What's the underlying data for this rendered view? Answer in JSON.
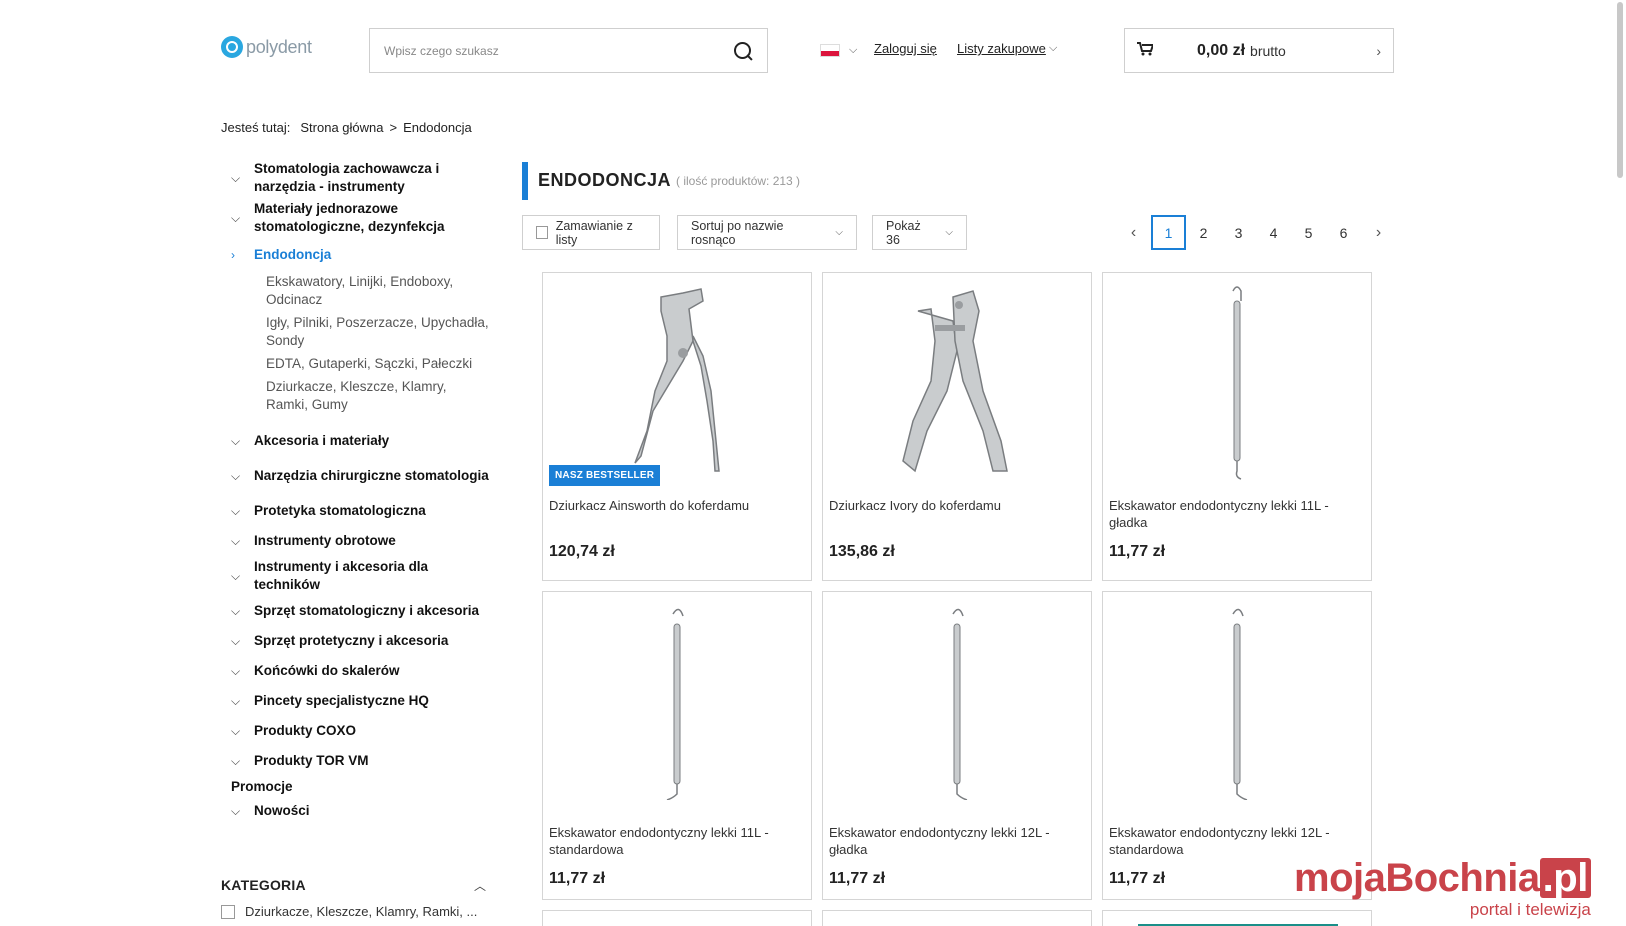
{
  "header": {
    "logo_text_a": "pd",
    "logo_text_b": "polydent",
    "search_placeholder": "Wpisz czego szukasz",
    "login": "Zaloguj się",
    "lists": "Listy zakupowe",
    "cart_amount": "0,00 zł",
    "cart_suffix": "brutto"
  },
  "breadcrumb": {
    "label": "Jesteś tutaj:",
    "home": "Strona główna",
    "sep": ">",
    "current": "Endodoncja"
  },
  "sidebar": {
    "items": [
      {
        "label": "Stomatologia zachowawcza i narzędzia - instrumenty"
      },
      {
        "label": "Materiały jednorazowe stomatologiczne, dezynfekcja"
      },
      {
        "label": "Endodoncja"
      },
      {
        "label": "Akcesoria i materiały"
      },
      {
        "label": "Narzędzia chirurgiczne stomatologia"
      },
      {
        "label": "Protetyka stomatologiczna"
      },
      {
        "label": "Instrumenty obrotowe"
      },
      {
        "label": "Instrumenty i akcesoria dla techników"
      },
      {
        "label": "Sprzęt stomatologiczny i akcesoria"
      },
      {
        "label": "Sprzęt protetyczny i akcesoria"
      },
      {
        "label": "Końcówki do skalerów"
      },
      {
        "label": "Pincety specjalistyczne HQ"
      },
      {
        "label": "Produkty COXO"
      },
      {
        "label": "Produkty TOR VM"
      },
      {
        "label": "Promocje"
      },
      {
        "label": "Nowości"
      }
    ],
    "subitems": [
      "Ekskawatory, Linijki, Endoboxy, Odcinacz",
      "Igły, Pilniki, Poszerzacze, Upychadła, Sondy",
      "EDTA, Gutaperki, Sączki, Pałeczki",
      "Dziurkacze, Kleszcze, Klamry, Ramki, Gumy"
    ],
    "filter_title": "KATEGORIA",
    "filter_option": "Dziurkacze, Kleszcze, Klamry, Ramki, ..."
  },
  "main": {
    "title": "ENDODONCJA",
    "count": "( ilość produktów: 213 )",
    "order_from_list": "Zamawianie z listy",
    "sort": "Sortuj po nazwie rosnąco",
    "show": "Pokaż 36",
    "pages": [
      "1",
      "2",
      "3",
      "4",
      "5",
      "6"
    ],
    "current_page": "1"
  },
  "products": [
    {
      "name": "Dziurkacz Ainsworth do koferdamu",
      "price": "120,74 zł",
      "badge": "NASZ BESTSELLER"
    },
    {
      "name": "Dziurkacz Ivory do koferdamu",
      "price": "135,86 zł"
    },
    {
      "name": "Ekskawator endodontyczny lekki 11L - gładka",
      "price": "11,77 zł"
    },
    {
      "name": "Ekskawator endodontyczny lekki 11L - standardowa",
      "price": "11,77 zł"
    },
    {
      "name": "Ekskawator endodontyczny lekki 12L - gładka",
      "price": "11,77 zł"
    },
    {
      "name": "Ekskawator endodontyczny lekki 12L - standardowa",
      "price": "11,77 zł"
    }
  ],
  "watermark": {
    "main": "mojaBochnia",
    "tld": ".pl",
    "sub": "portal i telewizja"
  },
  "colors": {
    "accent": "#1a7fd6",
    "brand": "#2aa7e0",
    "watermark": "#c9434a"
  }
}
